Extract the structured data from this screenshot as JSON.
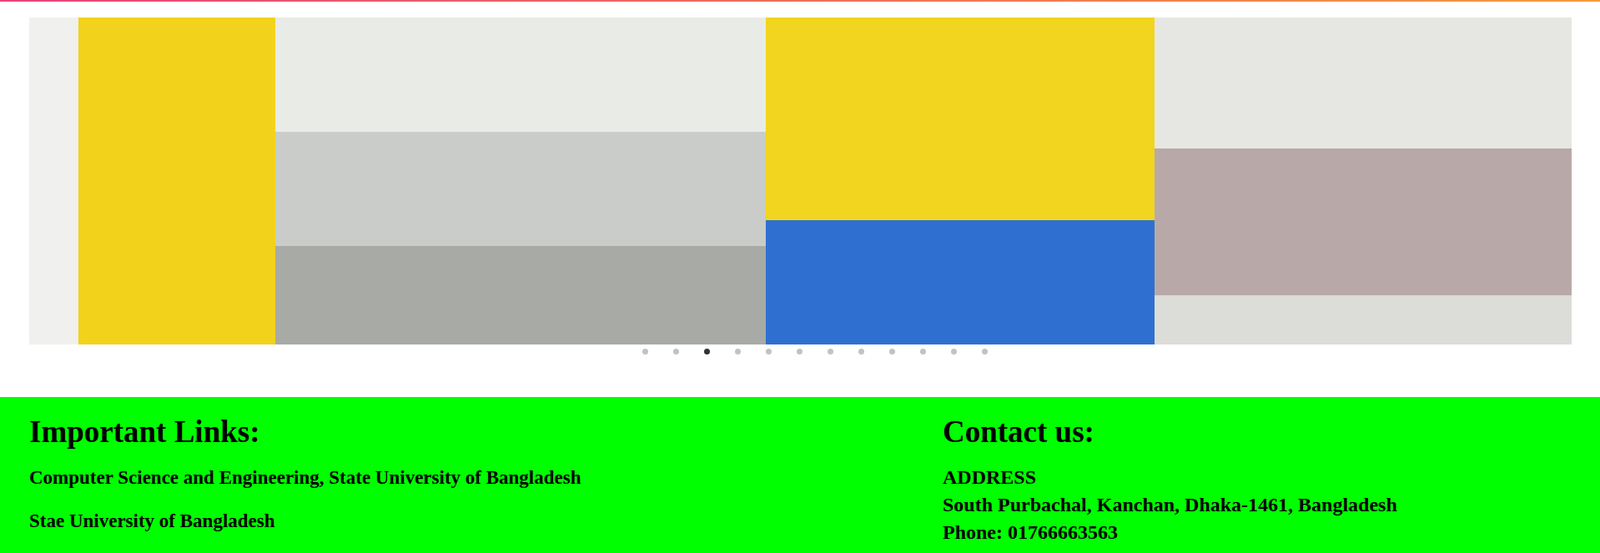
{
  "carousel": {
    "slides": [
      {
        "kind": "speaker"
      },
      {
        "kind": "lab"
      },
      {
        "kind": "stage"
      },
      {
        "kind": "group"
      }
    ],
    "dots": [
      {
        "selected": false
      },
      {
        "selected": false
      },
      {
        "selected": true
      },
      {
        "selected": false
      },
      {
        "selected": false
      },
      {
        "selected": false
      },
      {
        "selected": false
      },
      {
        "selected": false
      },
      {
        "selected": false
      },
      {
        "selected": false
      },
      {
        "selected": false
      },
      {
        "selected": false
      }
    ]
  },
  "footer": {
    "links_title": "Important Links:",
    "links": [
      "Computer Science and Engineering, State University of Bangladesh",
      "Stae University of Bangladesh"
    ],
    "contact_title": "Contact us:",
    "address_label": "ADDRESS",
    "address": "South Purbachal, Kanchan, Dhaka-1461, Bangladesh",
    "phone": "Phone: 01766663563"
  }
}
